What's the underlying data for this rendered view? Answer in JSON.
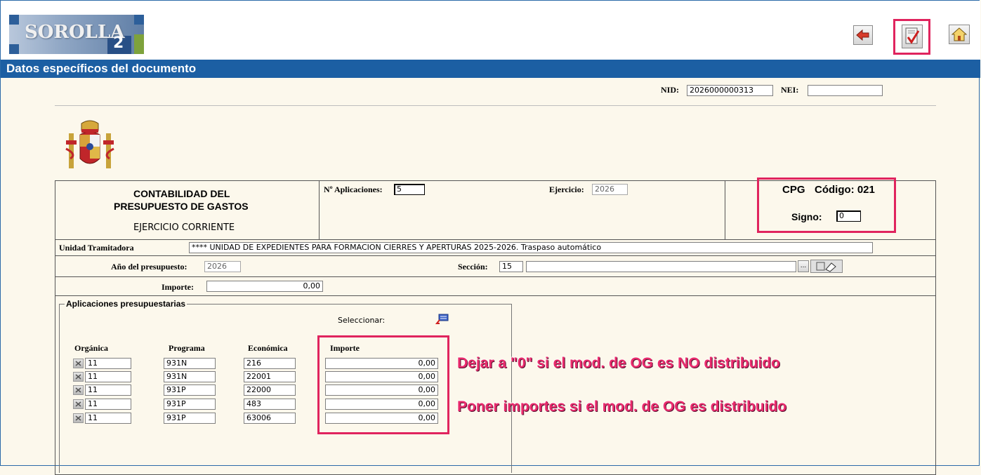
{
  "app": {
    "logo_text": "SOROLLA",
    "logo_num": "2"
  },
  "toolbar": {
    "back_icon": "arrow-left-icon",
    "validate_icon": "checkmark-document-icon",
    "home_icon": "home-icon"
  },
  "page_title": "Datos específicos del documento",
  "ids": {
    "nid_label": "NID:",
    "nid_value": "2026000000313",
    "nei_label": "NEI:",
    "nei_value": ""
  },
  "document": {
    "title_line1": "CONTABILIDAD DEL",
    "title_line2": "PRESUPUESTO DE GASTOS",
    "subtitle": "EJERCICIO CORRIENTE",
    "n_aplicaciones_label": "Nº Aplicaciones:",
    "n_aplicaciones_value": "5",
    "ejercicio_label": "Ejercicio:",
    "ejercicio_value": "2026",
    "cpg_label": "CPG",
    "codigo_label": "Código: 021",
    "signo_label": "Signo:",
    "signo_value": "0"
  },
  "unidad": {
    "label": "Unidad Tramitadora",
    "value": "**** UNIDAD DE EXPEDIENTES PARA FORMACION CIERRES Y APERTURAS 2025-2026. Traspaso automático"
  },
  "presupuesto": {
    "anio_label": "Año del presupuesto:",
    "anio_value": "2026",
    "seccion_label": "Sección:",
    "seccion_value": "15",
    "seccion_desc": ""
  },
  "importe": {
    "label": "Importe:",
    "value": "0,00"
  },
  "aplicaciones": {
    "legend": "Aplicaciones presupuestarias",
    "seleccionar_label": "Seleccionar:",
    "headers": {
      "organica": "Orgánica",
      "programa": "Programa",
      "economica": "Económica",
      "importe": "Importe"
    },
    "rows": [
      {
        "organica": "11",
        "programa": "931N",
        "economica": "216",
        "importe": "0,00"
      },
      {
        "organica": "11",
        "programa": "931N",
        "economica": "22001",
        "importe": "0,00"
      },
      {
        "organica": "11",
        "programa": "931P",
        "economica": "22000",
        "importe": "0,00"
      },
      {
        "organica": "11",
        "programa": "931P",
        "economica": "483",
        "importe": "0,00"
      },
      {
        "organica": "11",
        "programa": "931P",
        "economica": "63006",
        "importe": "0,00"
      }
    ]
  },
  "annotations": {
    "note1": "Dejar a \"0\" si el mod. de OG es NO distribuido",
    "note2": "Poner importes si el mod. de OG es distribuido"
  },
  "colors": {
    "titlebar": "#1c5fa3",
    "highlight": "#e0245e",
    "background": "#fcf8ec"
  }
}
